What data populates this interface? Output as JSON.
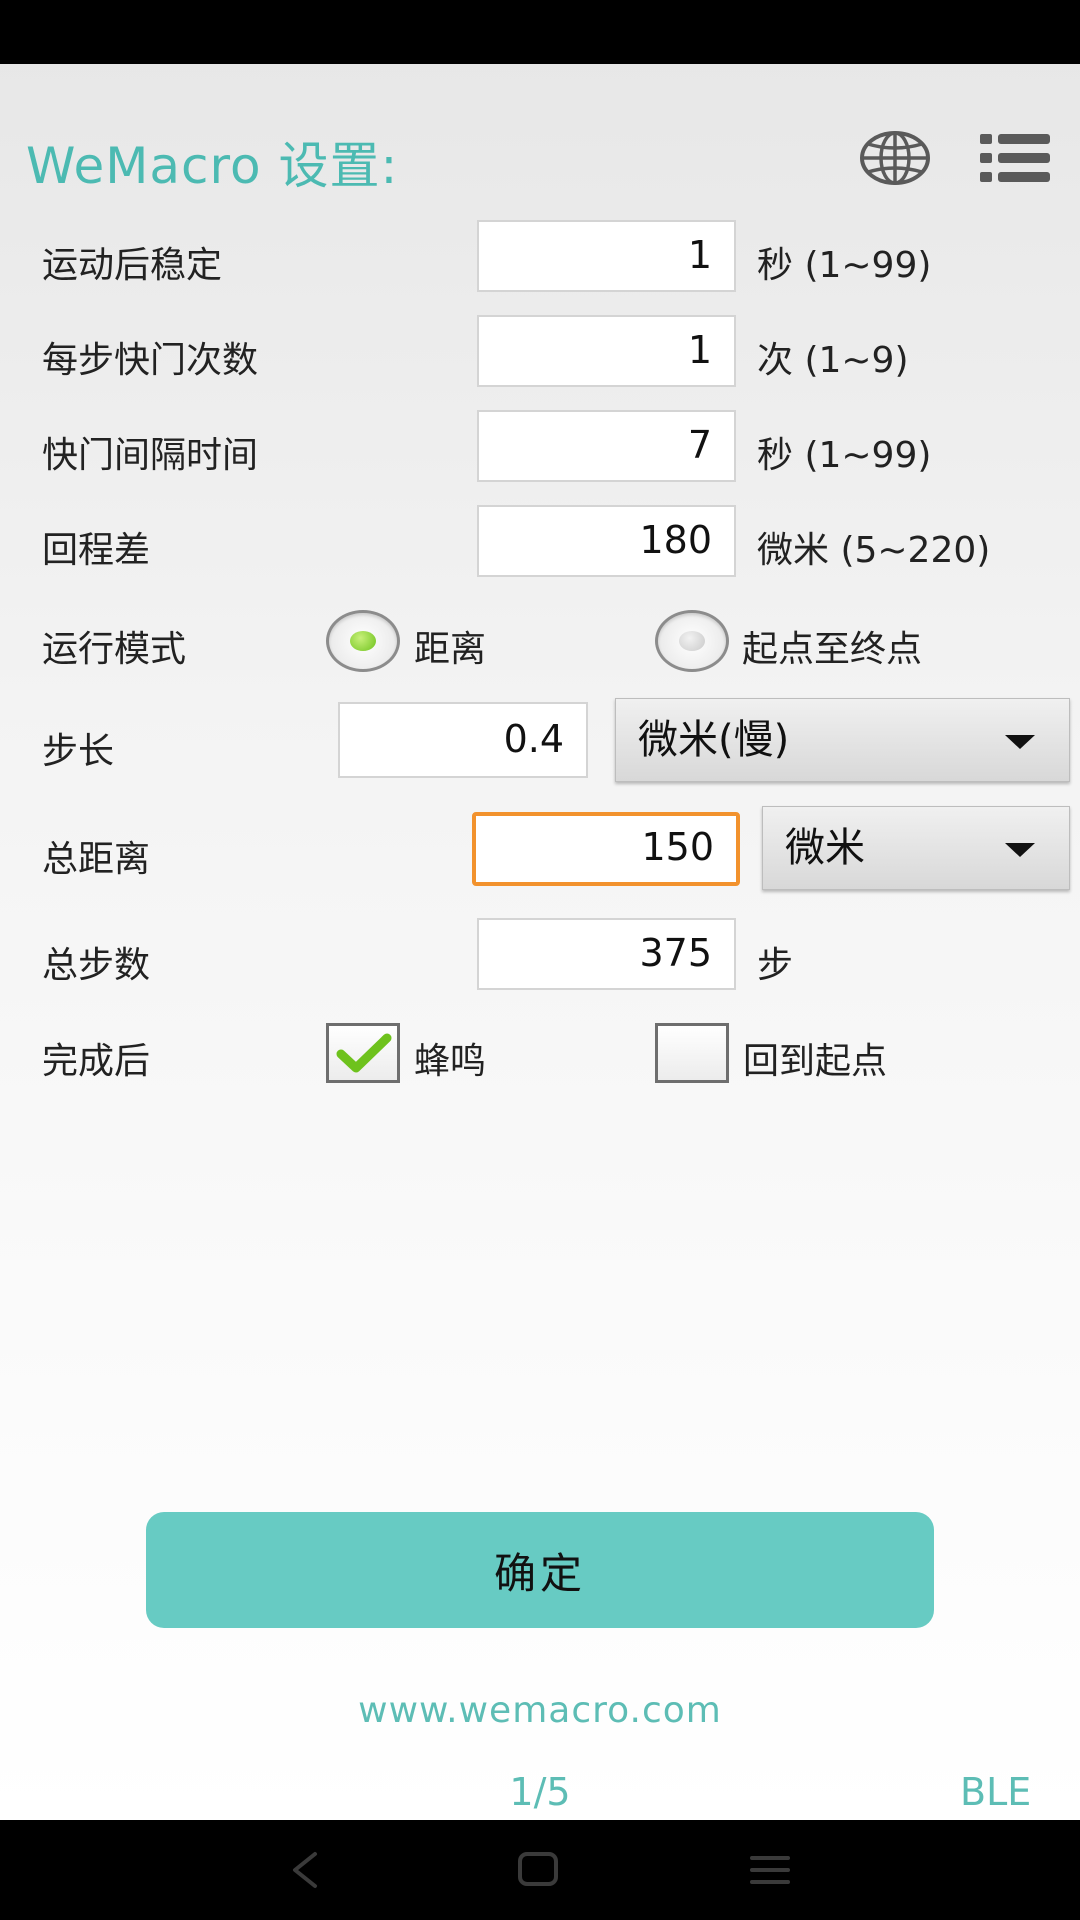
{
  "header": {
    "title": "WeMacro 设置:",
    "language_icon": "globe-icon",
    "menu_icon": "list-menu-icon"
  },
  "settings": {
    "settle_after_move": {
      "label": "运动后稳定",
      "value": "1",
      "unit": "秒 (1~99)"
    },
    "shutter_per_step": {
      "label": "每步快门次数",
      "value": "1",
      "unit": "次 (1~9)"
    },
    "shutter_interval": {
      "label": "快门间隔时间",
      "value": "7",
      "unit": "秒 (1~99)"
    },
    "backlash": {
      "label": "回程差",
      "value": "180",
      "unit": "微米 (5~220)"
    },
    "run_mode": {
      "label": "运行模式",
      "options": [
        {
          "label": "距离",
          "selected": true
        },
        {
          "label": "起点至终点",
          "selected": false
        }
      ]
    },
    "step_size": {
      "label": "步长",
      "value": "0.4",
      "unit_selected": "微米(慢)"
    },
    "total_distance": {
      "label": "总距离",
      "value": "150",
      "unit_selected": "微米"
    },
    "total_steps": {
      "label": "总步数",
      "value": "375",
      "unit": "步"
    },
    "after_complete": {
      "label": "完成后",
      "options": [
        {
          "label": "蜂鸣",
          "checked": true
        },
        {
          "label": "回到起点",
          "checked": false
        }
      ]
    }
  },
  "actions": {
    "confirm_label": "确定"
  },
  "footer": {
    "website": "www.wemacro.com",
    "page_indicator": "1/5",
    "connection_mode": "BLE"
  },
  "colors": {
    "accent_teal": "#4cbab2",
    "button_teal": "#67cbc3",
    "focus_orange": "#f2922d",
    "radio_selected_green": "#6ec21d"
  }
}
